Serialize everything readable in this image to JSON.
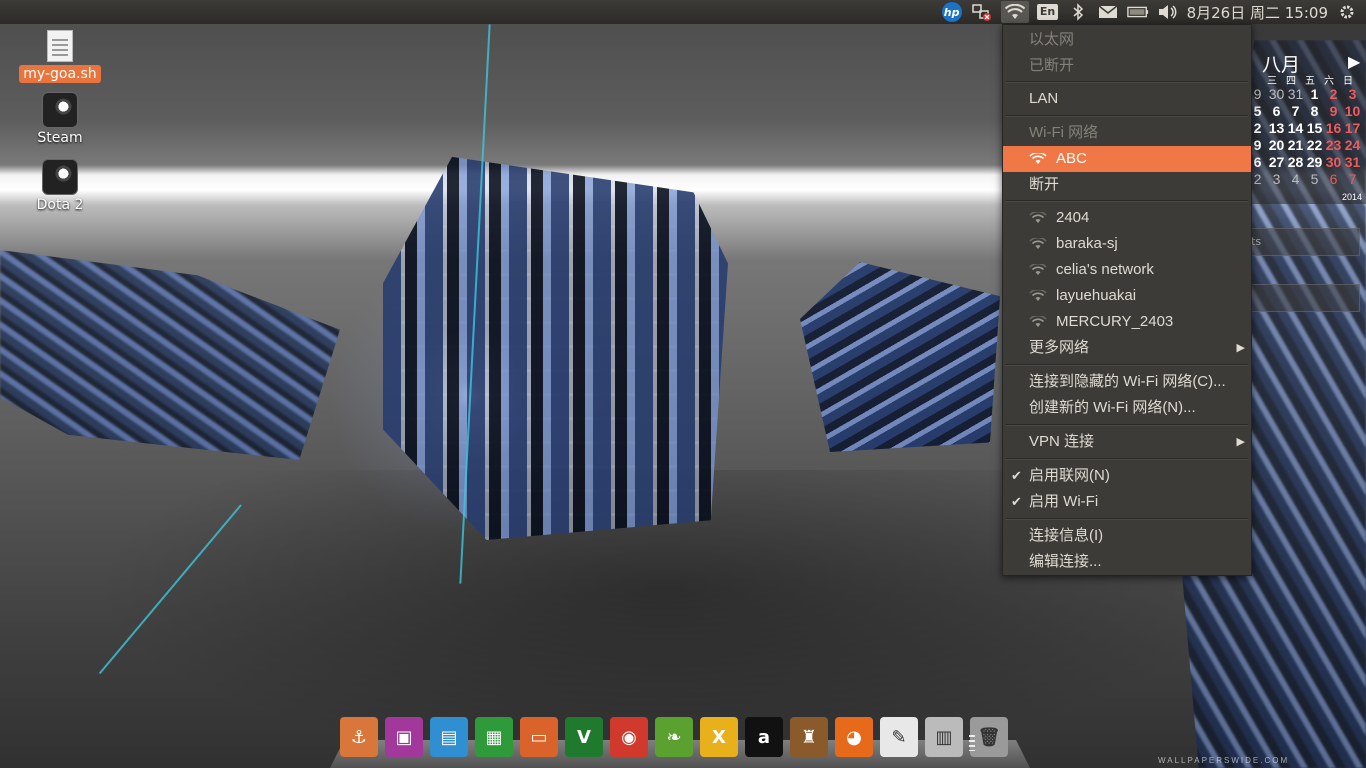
{
  "top_panel": {
    "keyboard_layout": "En",
    "clock": "8月26日 周二 15:09",
    "icons": [
      "hp-logo-icon",
      "network-wired-disconnected-icon",
      "wifi-icon",
      "keyboard-en-indicator",
      "bluetooth-icon",
      "mail-icon",
      "battery-icon",
      "volume-icon",
      "gear-icon"
    ],
    "hp_text": "hp"
  },
  "desktop_icons": [
    {
      "label": "my-goa.sh",
      "icon": "shell-script-icon",
      "selected": true
    },
    {
      "label": "Steam",
      "icon": "steam-icon",
      "selected": false
    },
    {
      "label": "Dota 2",
      "icon": "steam-icon",
      "selected": false
    }
  ],
  "calendar": {
    "month": "八月",
    "next_arrow": "▶",
    "weekdays": [
      "三",
      "四",
      "五",
      "六",
      "日"
    ],
    "weekdays_partial_first": "",
    "rows": [
      [
        "9",
        "30",
        "31",
        "1",
        "2",
        "3"
      ],
      [
        "5",
        "6",
        "7",
        "8",
        "9",
        "10"
      ],
      [
        "2",
        "13",
        "14",
        "15",
        "16",
        "17"
      ],
      [
        "9",
        "20",
        "21",
        "22",
        "23",
        "24"
      ],
      [
        "6",
        "27",
        "28",
        "29",
        "30",
        "31"
      ],
      [
        "2",
        "3",
        "4",
        "5",
        "6",
        "7"
      ]
    ],
    "year": "2014",
    "field_text": "ts"
  },
  "network_menu": {
    "ethernet_header": "以太网",
    "ethernet_status": "已断开",
    "lan": "LAN",
    "wifi_header": "Wi-Fi 网络",
    "connected_network": "ABC",
    "disconnect": "断开",
    "networks": [
      "2404",
      "baraka-sj",
      "celia's network",
      "layuehuakai",
      "MERCURY_2403"
    ],
    "more_networks": "更多网络",
    "connect_hidden": "连接到隐藏的 Wi-Fi 网络(C)...",
    "create_new": "创建新的 Wi-Fi 网络(N)...",
    "vpn": "VPN 连接",
    "enable_networking": "启用联网(N)",
    "enable_wifi": "启用 Wi-Fi",
    "connection_info": "连接信息(I)",
    "edit_connections": "编辑连接...",
    "check_mark": "✔",
    "submenu_arrow": "▶"
  },
  "dock": {
    "items": [
      {
        "name": "anchor-launcher-icon",
        "color": "#d9763a",
        "glyph": "⚓"
      },
      {
        "name": "video-player-icon",
        "color": "#a2379c",
        "glyph": "▣"
      },
      {
        "name": "libreoffice-draw-icon",
        "color": "#2f8fd0",
        "glyph": "▤"
      },
      {
        "name": "libreoffice-calc-icon",
        "color": "#2f9a3a",
        "glyph": "▦"
      },
      {
        "name": "libreoffice-impress-icon",
        "color": "#d9632a",
        "glyph": "▭"
      },
      {
        "name": "vim-icon",
        "color": "#1f7a2e",
        "glyph": "V"
      },
      {
        "name": "chrome-icon",
        "color": "#d0392b",
        "glyph": "◉"
      },
      {
        "name": "leafpad-icon",
        "color": "#5aa12f",
        "glyph": "❧"
      },
      {
        "name": "xchat-icon",
        "color": "#e8b01a",
        "glyph": "X"
      },
      {
        "name": "anki-icon",
        "color": "#111111",
        "glyph": "a"
      },
      {
        "name": "chess-icon",
        "color": "#8a5a2a",
        "glyph": "♜"
      },
      {
        "name": "firefox-icon",
        "color": "#e66a1a",
        "glyph": "◕"
      },
      {
        "name": "text-editor-icon",
        "color": "#e8e8e8",
        "glyph": "✎"
      },
      {
        "name": "file-manager-icon",
        "color": "#bbbbbb",
        "glyph": "▥"
      },
      {
        "name": "trash-icon",
        "color": "#9a9a9a",
        "glyph": "🗑"
      }
    ]
  },
  "watermark": "WALLPAPERSWIDE.COM",
  "colors": {
    "accent": "#f07746",
    "menu_bg": "#3c3b37",
    "panel_bg": "#3c3b37"
  }
}
